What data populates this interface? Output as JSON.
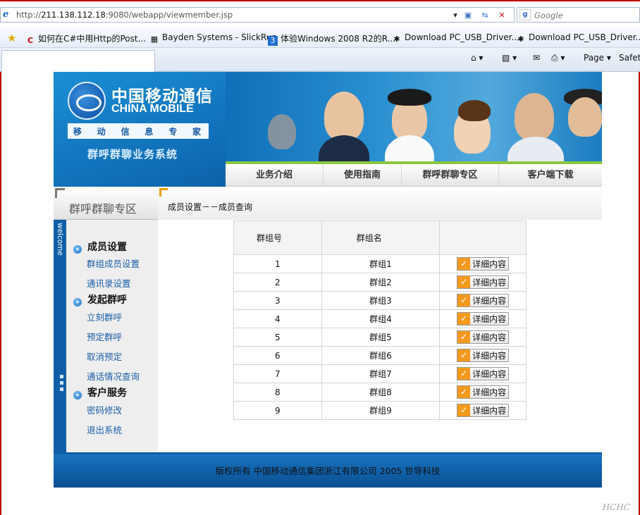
{
  "browser": {
    "url_prefix": "http://",
    "url_host": "211.138.112.18",
    "url_rest": ":9080/webapp/viewmember.jsp",
    "search_placeholder": "Google",
    "favorites": [
      "如何在C#中用Http的Post...",
      "Bayden Systems - SlickRun",
      "体验Windows 2008 R2的R...",
      "Download PC_USB_Driver...",
      "Download PC_USB_Driver..."
    ],
    "commands": {
      "page": "Page ▾",
      "safety": "Safety"
    }
  },
  "header": {
    "logo_cn": "中国移动通信",
    "logo_en": "CHINA MOBILE",
    "slogan": "移动信息专家",
    "system_title": "群呼群聊业务系统"
  },
  "nav": [
    "业务介绍",
    "使用指南",
    "群呼群聊专区",
    "客户端下载"
  ],
  "sidebar": {
    "title": "群呼群聊专区",
    "welcome": "welcome",
    "sections": [
      {
        "title": "成员设置",
        "links": [
          "群组成员设置",
          "通讯录设置"
        ]
      },
      {
        "title": "发起群呼",
        "links": [
          "立刻群呼",
          "预定群呼",
          "取消预定",
          "通话情况查询"
        ]
      },
      {
        "title": "客户服务",
        "links": [
          "密码修改",
          "退出系统"
        ]
      }
    ]
  },
  "content": {
    "breadcrumb": "成员设置－－成员查询",
    "table": {
      "headers": [
        "群组号",
        "群组名",
        ""
      ],
      "rows": [
        {
          "id": "1",
          "name": "群组1"
        },
        {
          "id": "2",
          "name": "群组2"
        },
        {
          "id": "3",
          "name": "群组3"
        },
        {
          "id": "4",
          "name": "群组4"
        },
        {
          "id": "5",
          "name": "群组5"
        },
        {
          "id": "6",
          "name": "群组6"
        },
        {
          "id": "7",
          "name": "群组7"
        },
        {
          "id": "8",
          "name": "群组8"
        },
        {
          "id": "9",
          "name": "群组9"
        }
      ],
      "action_label": "详细内容"
    }
  },
  "footer": {
    "copyright": "版权所有  中国移动通信集团浙江有限公司  2005 世导科技"
  },
  "watermark": "HCHC",
  "colors": {
    "brand_blue": "#0f5ea6",
    "accent_green": "#8dc63f",
    "button_orange": "#f39a1e",
    "link_blue": "#1a5fa8"
  }
}
